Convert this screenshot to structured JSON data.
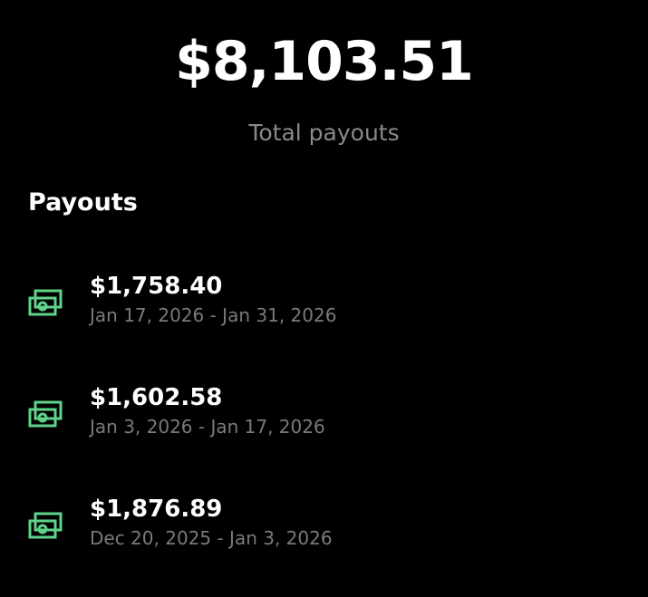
{
  "summary": {
    "total_amount": "$8,103.51",
    "total_label": "Total payouts"
  },
  "payouts": {
    "title": "Payouts",
    "icon": "money-icon",
    "icon_color": "#5fd38a",
    "items": [
      {
        "amount": "$1,758.40",
        "range": "Jan 17, 2026 - Jan 31, 2026"
      },
      {
        "amount": "$1,602.58",
        "range": "Jan 3, 2026 - Jan 17, 2026"
      },
      {
        "amount": "$1,876.89",
        "range": "Dec 20, 2025 - Jan 3, 2026"
      }
    ]
  }
}
